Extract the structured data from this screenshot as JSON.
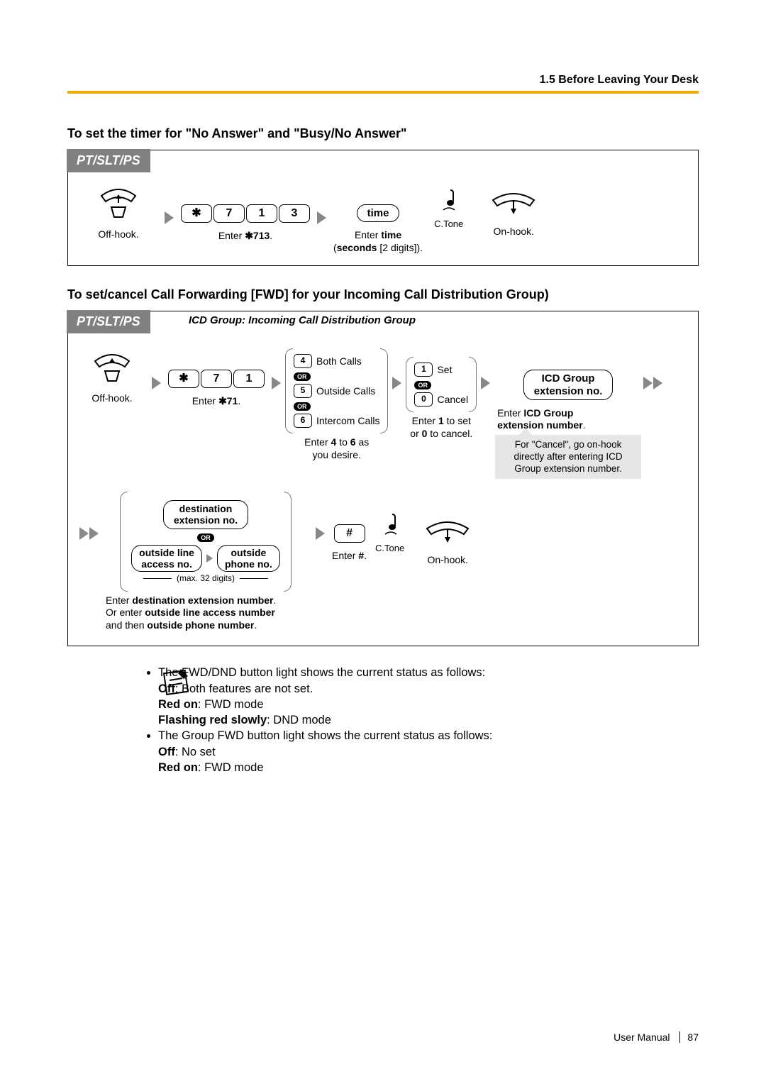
{
  "header": {
    "crumb": "1.5 Before Leaving Your Desk"
  },
  "section1": {
    "title": "To set the timer for \"No Answer\" and \"Busy/No Answer\"",
    "tag": "PT/SLT/PS",
    "steps": {
      "offhook": "Off-hook.",
      "keys": {
        "star": "✱",
        "d1": "7",
        "d2": "1",
        "d3": "3"
      },
      "enter713": "Enter ✱713.",
      "time_field": "time",
      "enter_time_1": "Enter time",
      "enter_time_2": "(seconds [2 digits]).",
      "ctone": "C.Tone",
      "onhook": "On-hook."
    }
  },
  "section2": {
    "title": "To set/cancel Call Forwarding [FWD] for your Incoming Call Distribution Group)",
    "tag": "PT/SLT/PS",
    "subtitle": "ICD Group: Incoming Call Distribution Group",
    "row1": {
      "offhook": "Off-hook.",
      "keys": {
        "star": "✱",
        "d1": "7",
        "d2": "1"
      },
      "enter71": "Enter ✱71.",
      "opt4": "4",
      "opt4_lbl": "Both Calls",
      "or": "OR",
      "opt5": "5",
      "opt5_lbl": "Outside Calls",
      "opt6": "6",
      "opt6_lbl": "Intercom Calls",
      "enter46_1": "Enter 4 to 6 as",
      "enter46_2": "you desire.",
      "set1": "1",
      "set_lbl": "Set",
      "can0": "0",
      "can_lbl": "Cancel",
      "enter10_1": "Enter 1 to set",
      "enter10_2": "or 0 to cancel.",
      "icd_field_1": "ICD Group",
      "icd_field_2": "extension no.",
      "enter_icd_1": "Enter ICD Group",
      "enter_icd_2": "extension number."
    },
    "note": {
      "l1": "For \"Cancel\", go on-hook",
      "l2": "directly after entering ICD",
      "l3": "Group extension number."
    },
    "row2": {
      "dest_1": "destination",
      "dest_2": "extension no.",
      "or": "OR",
      "ola_1": "outside line",
      "ola_2": "access no.",
      "opn_1": "outside",
      "opn_2": "phone no.",
      "max": "(max. 32 digits)",
      "cap_1": "Enter destination extension number.",
      "cap_2": "Or enter outside line access number",
      "cap_3": "and then outside phone number.",
      "hash": "#",
      "enter_hash": "Enter #.",
      "ctone": "C.Tone",
      "onhook": "On-hook."
    }
  },
  "notes": {
    "b1": "The FWD/DND button light shows the current status as follows:",
    "b1_off": "Off: Both features are not set.",
    "b1_red": "Red on: FWD mode",
    "b1_flash": "Flashing red slowly: DND mode",
    "b2": "The Group FWD button light shows the current status as follows:",
    "b2_off": "Off: No set",
    "b2_red": "Red on: FWD mode"
  },
  "footer": {
    "manual": "User Manual",
    "page": "87"
  }
}
